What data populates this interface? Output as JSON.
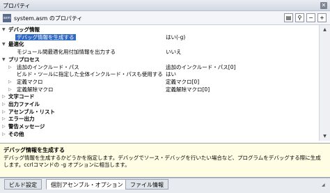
{
  "window": {
    "title": "プロパティ"
  },
  "toolbar": {
    "file_icon_text": "asm",
    "target": "system.asm のプロパティ"
  },
  "rows": [
    {
      "kind": "cat",
      "toggle": "▼",
      "name": "デバッグ情報",
      "value": ""
    },
    {
      "kind": "item",
      "toggle": "",
      "name": "デバッグ情報を生成する",
      "value": "はい(-g)",
      "selected": true
    },
    {
      "kind": "cat",
      "toggle": "▼",
      "name": "最適化",
      "value": ""
    },
    {
      "kind": "item",
      "toggle": "",
      "name": "モジュール間最適化用付加情報を出力する",
      "value": "いいえ"
    },
    {
      "kind": "cat",
      "toggle": "▼",
      "name": "プリプロセス",
      "value": ""
    },
    {
      "kind": "sub",
      "toggle": "▷",
      "name": "追加のインクルード・パス",
      "value": "追加のインクルード・パス[0]"
    },
    {
      "kind": "item",
      "toggle": "",
      "name": "ビルド・ツールに指定した全体インクルード・パスも使用する",
      "value": "はい"
    },
    {
      "kind": "sub",
      "toggle": "▷",
      "name": "定義マクロ",
      "value": "定義マクロ[0]"
    },
    {
      "kind": "sub",
      "toggle": "▷",
      "name": "定義解除マクロ",
      "value": "定義解除マクロ[0]"
    },
    {
      "kind": "cat",
      "toggle": "▷",
      "name": "文字コード",
      "value": ""
    },
    {
      "kind": "cat",
      "toggle": "▷",
      "name": "出力ファイル",
      "value": ""
    },
    {
      "kind": "cat",
      "toggle": "▷",
      "name": "アセンブル・リスト",
      "value": ""
    },
    {
      "kind": "cat",
      "toggle": "▷",
      "name": "エラー出力",
      "value": ""
    },
    {
      "kind": "cat",
      "toggle": "▷",
      "name": "警告メッセージ",
      "value": ""
    },
    {
      "kind": "cat",
      "toggle": "▷",
      "name": "その他",
      "value": ""
    }
  ],
  "description": {
    "title": "デバッグ情報を生成する",
    "text": "デバッグ情報を生成するかどうかを指定します。デバッグでソース・デバッグを行いたい場合など、プログラムをデバッグする際に生成します。ccrlコマンドの -g オプションに相当します。"
  },
  "tabs": [
    {
      "label": "ビルド設定",
      "active": false
    },
    {
      "label": "個別アセンブル・オプション",
      "active": true
    },
    {
      "label": "ファイル情報",
      "active": false
    }
  ]
}
